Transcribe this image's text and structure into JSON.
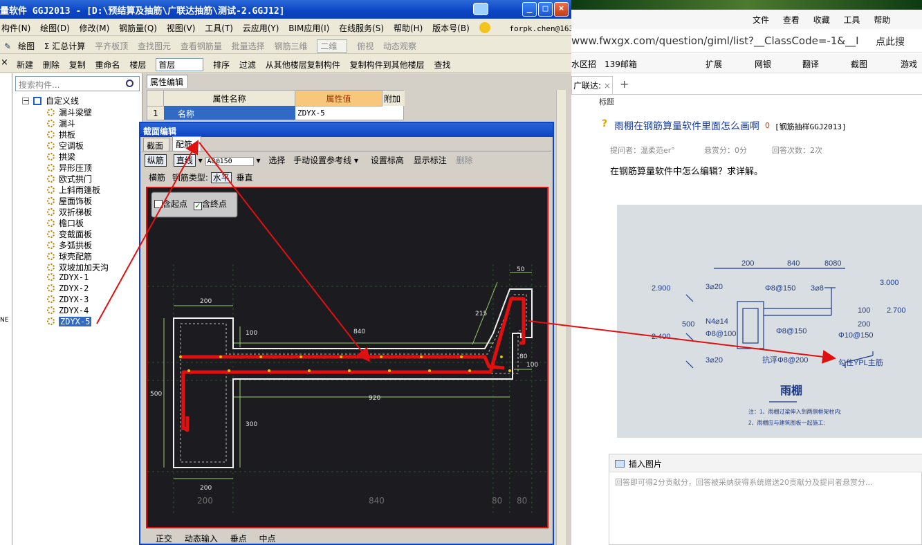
{
  "app": {
    "title": "量软件 GGJ2013 - [D:\\预结算及抽筋\\广联达抽筋\\测试-2.GGJ12]",
    "menu": [
      "构件(N)",
      "绘图(D)",
      "修改(M)",
      "钢筋量(Q)",
      "视图(V)",
      "工具(T)",
      "云应用(Y)",
      "BIM应用(I)",
      "在线服务(S)",
      "帮助(H)",
      "版本号(B)"
    ],
    "account": "forpk.chen@163.com",
    "toolbar1": [
      "绘图",
      "Σ 汇总计算",
      "平齐板顶",
      "查找图元",
      "查看钢筋量",
      "批量选择",
      "钢筋三维",
      "二维",
      "俯视",
      "动态观察"
    ],
    "toolbar2": [
      "新建",
      "删除",
      "复制",
      "重命名",
      "楼层",
      "首层",
      "排序",
      "过滤",
      "从其他楼层复制构件",
      "复制构件到其他楼层",
      "查找"
    ],
    "search_placeholder": "搜索构件...",
    "tree_root": "自定义线",
    "tree_items": [
      "漏斗梁壁",
      "漏斗",
      "拱板",
      "空调板",
      "拱梁",
      "异形压顶",
      "欧式拱门",
      "上斜雨篷板",
      "屋面饰板",
      "双折梯板",
      "檐口板",
      "变截面板",
      "多弧拱板",
      "球壳配筋",
      "双坡加加天沟",
      "ZDYX-1",
      "ZDYX-2",
      "ZDYX-3",
      "ZDYX-4",
      "ZDYX-5"
    ],
    "selected_item": "ZDYX-5",
    "prop_tab": "属性编辑",
    "prop_headers": [
      "属性名称",
      "属性值",
      "附加"
    ],
    "prop_row": {
      "index": "1",
      "name": "名称",
      "value": "ZDYX-5"
    },
    "edge_label": "NE"
  },
  "dialog": {
    "title": "截面编辑",
    "tabs": [
      "截面",
      "配筋"
    ],
    "tool_row1": [
      "纵筋",
      "直线",
      "A8@150",
      "选择",
      "手动设置参考线",
      "设置标高",
      "显示标注",
      "删除"
    ],
    "tool_row2": [
      "横筋",
      "钢筋类型:",
      "水平",
      "垂直"
    ],
    "checkboxes": [
      {
        "label": "含起点",
        "checked": false
      },
      {
        "label": "含终点",
        "checked": true
      }
    ],
    "dims": [
      "200",
      "100",
      "840",
      "50",
      "215",
      "100",
      "80",
      "920",
      "500",
      "300",
      "200",
      "200",
      "840",
      "80",
      "80"
    ],
    "status": [
      "正交",
      "动态输入",
      "垂点",
      "中点"
    ]
  },
  "browser": {
    "menu": [
      "文件",
      "查看",
      "收藏",
      "工具",
      "帮助"
    ],
    "url": "www.fwxgx.com/question/giml/list?__ClassCode=-1&__I",
    "url_hint": "点此搜",
    "favorites": [
      "水区招",
      "139邮箱"
    ],
    "toolbar": [
      "扩展",
      "网银",
      "翻译",
      "截图",
      "游戏"
    ],
    "tab_label": "广联达:",
    "section_label": "标题",
    "question_title": "雨棚在钢筋算量软件里面怎么画啊",
    "score": "0",
    "tag": "[钢筋抽样GGJ2013]",
    "meta": {
      "asker": "提问者：温柔范er°",
      "reward": "悬赏分：0分",
      "answers": "回答次数：2次"
    },
    "question_body": "在钢筋算量软件中怎么编辑？求详解。",
    "insert_image": "插入图片",
    "answer_placeholder": "回答即可得2分贡献分，回答被采纳获得系统赠送20贡献分及提问者悬赏分..."
  },
  "photo": {
    "labels": [
      "200",
      "840",
      "8080",
      "2.900",
      "3⌀20",
      "Φ8@150",
      "3⌀8",
      "3.000",
      "2.700",
      "500",
      "N4⌀14",
      "Φ8@100",
      "Φ8@150",
      "100",
      "200",
      "Φ10@150",
      "2.400",
      "3⌀20",
      "抗浮Φ8@200",
      "勾住YPL主筋",
      "雨棚",
      "注：1、雨棚过梁伸入到两侧框架柱内;",
      "2、雨棚应与建筑图板一起施工;"
    ]
  },
  "colors": {
    "accent": "#0b44c4",
    "arrow": "#e01010",
    "rebar": "#e01010"
  }
}
